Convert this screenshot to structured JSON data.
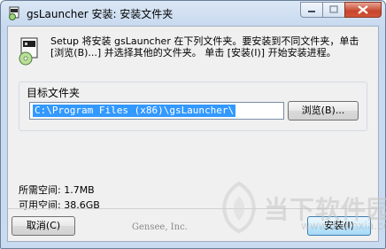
{
  "window": {
    "title": "gsLauncher 安装: 安装文件夹"
  },
  "description": "Setup 将安装 gsLauncher 在下列文件夹。要安装到不同文件夹，单击 [浏览(B)...] 并选择其他的文件夹。 单击 [安装(I)] 开始安装进程。",
  "target_folder": {
    "label": "目标文件夹",
    "path": "C:\\Program Files (x86)\\gsLauncher\\",
    "browse_label": "浏览(B)..."
  },
  "space": {
    "required": "所需空间: 1.7MB",
    "available": "可用空间: 38.6GB"
  },
  "vendor": "Gensee, Inc.",
  "buttons": {
    "cancel": "取消(C)",
    "install": "安装(I)"
  },
  "watermark": {
    "text": "当下软件园",
    "url": "www.downxia.com"
  },
  "icons": {
    "title": "installer-icon",
    "setup": "installer-icon",
    "minimize": "minimize-icon",
    "maximize": "maximize-icon",
    "close": "close-icon"
  }
}
